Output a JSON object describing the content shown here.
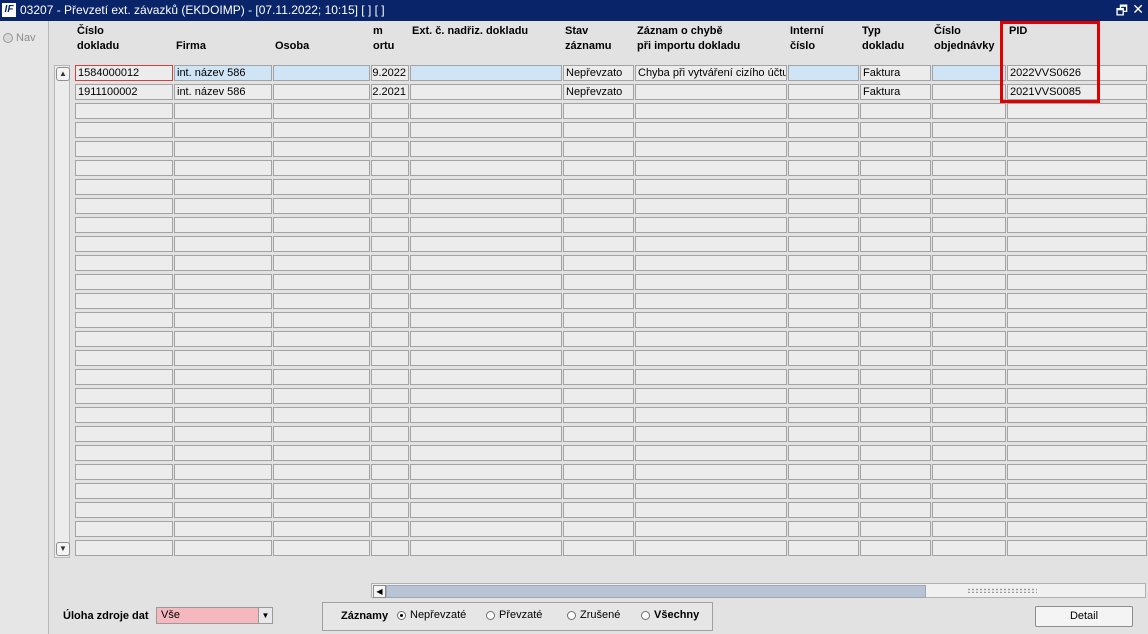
{
  "window": {
    "title": "03207 - Převzetí ext. závazků (EKDOIMP) - [07.11.2022; 10:15]  [ ]  [ ]",
    "logo_text": "IF",
    "restore_glyph": "🗗",
    "close_glyph": "✕"
  },
  "nav": {
    "label": "Nav"
  },
  "columns": [
    {
      "l1": "Číslo",
      "l2": "dokladu"
    },
    {
      "l1": "",
      "l2": "Firma"
    },
    {
      "l1": "",
      "l2": "Osoba"
    },
    {
      "l1": "m",
      "l2": "ortu"
    },
    {
      "l1": "Ext. č. nadřiz. dokladu",
      "l2": ""
    },
    {
      "l1": "Stav",
      "l2": "záznamu"
    },
    {
      "l1": "Záznam o chybě",
      "l2": "při importu dokladu"
    },
    {
      "l1": "Interní",
      "l2": "číslo"
    },
    {
      "l1": "Typ",
      "l2": "dokladu"
    },
    {
      "l1": "Číslo",
      "l2": "objednávky"
    },
    {
      "l1": "PID",
      "l2": ""
    }
  ],
  "rows": [
    [
      "1584000012",
      "int. název 586",
      "",
      "9.2022",
      "",
      "Nepřevzato",
      "Chyba při vytváření cizího účtu",
      "",
      "Faktura",
      "",
      "2022VVS0626"
    ],
    [
      "1911100002",
      "int. název 586",
      "",
      "2.2021",
      "",
      "Nepřevzato",
      "",
      "",
      "Faktura",
      "",
      "2021VVS0085"
    ]
  ],
  "footer": {
    "uloha_label": "Úloha zdroje dat",
    "uloha_value": "Vše",
    "zaznamy_label": "Záznamy",
    "options": [
      "Nepřevzaté",
      "Převzaté",
      "Zrušené",
      "Všechny"
    ],
    "selected_option": "Nepřevzaté",
    "detail_label": "Detail"
  }
}
